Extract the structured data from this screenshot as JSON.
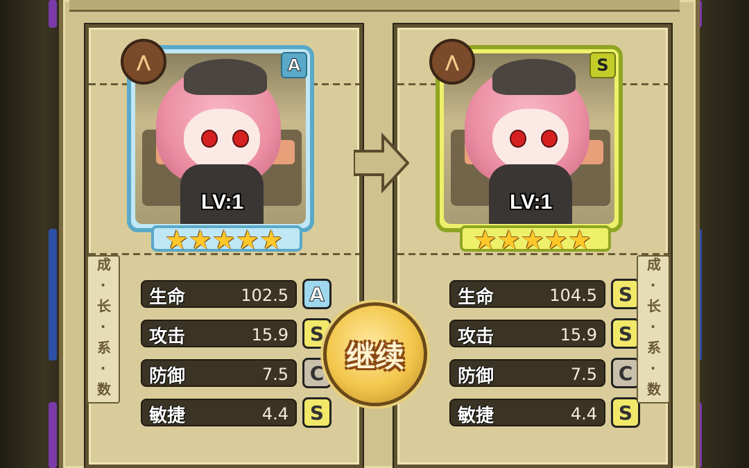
{
  "continue_button_label": "继续",
  "growth_tag_text": "成·长·系·数",
  "left_card": {
    "level_text": "LV:1",
    "rank": "A",
    "stars": 5,
    "stats": [
      {
        "label": "生命",
        "value": "102.5",
        "grade": "A"
      },
      {
        "label": "攻击",
        "value": "15.9",
        "grade": "S"
      },
      {
        "label": "防御",
        "value": "7.5",
        "grade": "C"
      },
      {
        "label": "敏捷",
        "value": "4.4",
        "grade": "S"
      }
    ]
  },
  "right_card": {
    "level_text": "LV:1",
    "rank": "S",
    "stars": 5,
    "stats": [
      {
        "label": "生命",
        "value": "104.5",
        "grade": "S"
      },
      {
        "label": "攻击",
        "value": "15.9",
        "grade": "S"
      },
      {
        "label": "防御",
        "value": "7.5",
        "grade": "C"
      },
      {
        "label": "敏捷",
        "value": "4.4",
        "grade": "S"
      }
    ]
  },
  "colors": {
    "rank_a": "#5aa9c8",
    "rank_s": "#c4cc2a",
    "grade_c": "#c9c0ac",
    "button_gold": "#f2c64a"
  }
}
